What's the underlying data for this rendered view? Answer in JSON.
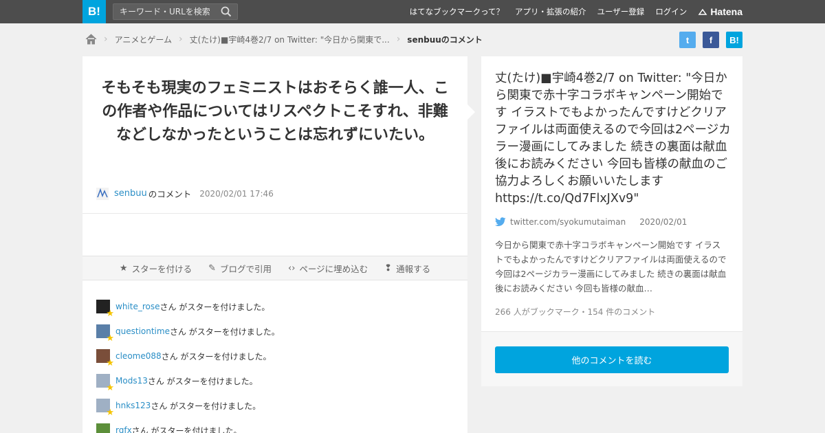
{
  "header": {
    "logo_text": "B!",
    "search_placeholder": "キーワード・URLを検索",
    "nav": [
      "はてなブックマークって？",
      "アプリ・拡張の紹介",
      "ユーザー登録",
      "ログイン"
    ],
    "brand": "Hatena"
  },
  "breadcrumb": {
    "home_icon": "home-icon",
    "items": [
      "アニメとゲーム",
      "丈(たけ)■宇崎4巻2/7 on Twitter: \"今日から関東で...",
      "senbuuのコメント"
    ]
  },
  "share": {
    "twitter": "t",
    "facebook": "f",
    "hatena": "B!"
  },
  "comment": {
    "text": "そもそも現実のフェミニストはおそらく誰一人、この作者や作品についてはリスペクトこそすれ、非難などしなかったということは忘れずにいたい。",
    "user": "senbuu",
    "suffix": "のコメント",
    "date": "2020/02/01 17:46"
  },
  "actions": {
    "star": "スターを付ける",
    "blog": "ブログで引用",
    "embed": "ページに埋め込む",
    "report": "通報する"
  },
  "stars_suffix": "さん がスターを付けました。",
  "stars": [
    {
      "user": "white_rose",
      "avatar_color": "#222"
    },
    {
      "user": "questiontime",
      "avatar_color": "#5a7fa8"
    },
    {
      "user": "cleome088",
      "avatar_color": "#7a4e3a"
    },
    {
      "user": "Mods13",
      "avatar_color": "#9fb0c4"
    },
    {
      "user": "hnks123",
      "avatar_color": "#9fb0c4"
    },
    {
      "user": "rgfx",
      "avatar_color": "#5c8f3a"
    }
  ],
  "entry": {
    "title": "丈(たけ)■宇崎4巻2/7 on Twitter: \"今日から関東で赤十字コラボキャンペーン開始です イラストでもよかったんですけどクリアファイルは両面使えるので今回は2ページカラー漫画にしてみました 続きの裏面は献血後にお読みください 今回も皆様の献血のご協力よろしくお願いいたします https://t.co/Qd7FlxJXv9\"",
    "source": "twitter.com/syokumutaiman",
    "date": "2020/02/01",
    "summary": "今日から関東で赤十字コラボキャンペーン開始です イラストでもよかったんですけどクリアファイルは両面使えるので今回は2ページカラー漫画にしてみました 続きの裏面は献血後にお読みください 今回も皆様の献血…",
    "counts": "266 人がブックマーク・154 件のコメント",
    "more_button": "他のコメントを読む"
  },
  "colors": {
    "accent": "#00a4de",
    "link": "#2a8ec6",
    "topbar": "#4d4d4d",
    "star": "#f5c400"
  }
}
